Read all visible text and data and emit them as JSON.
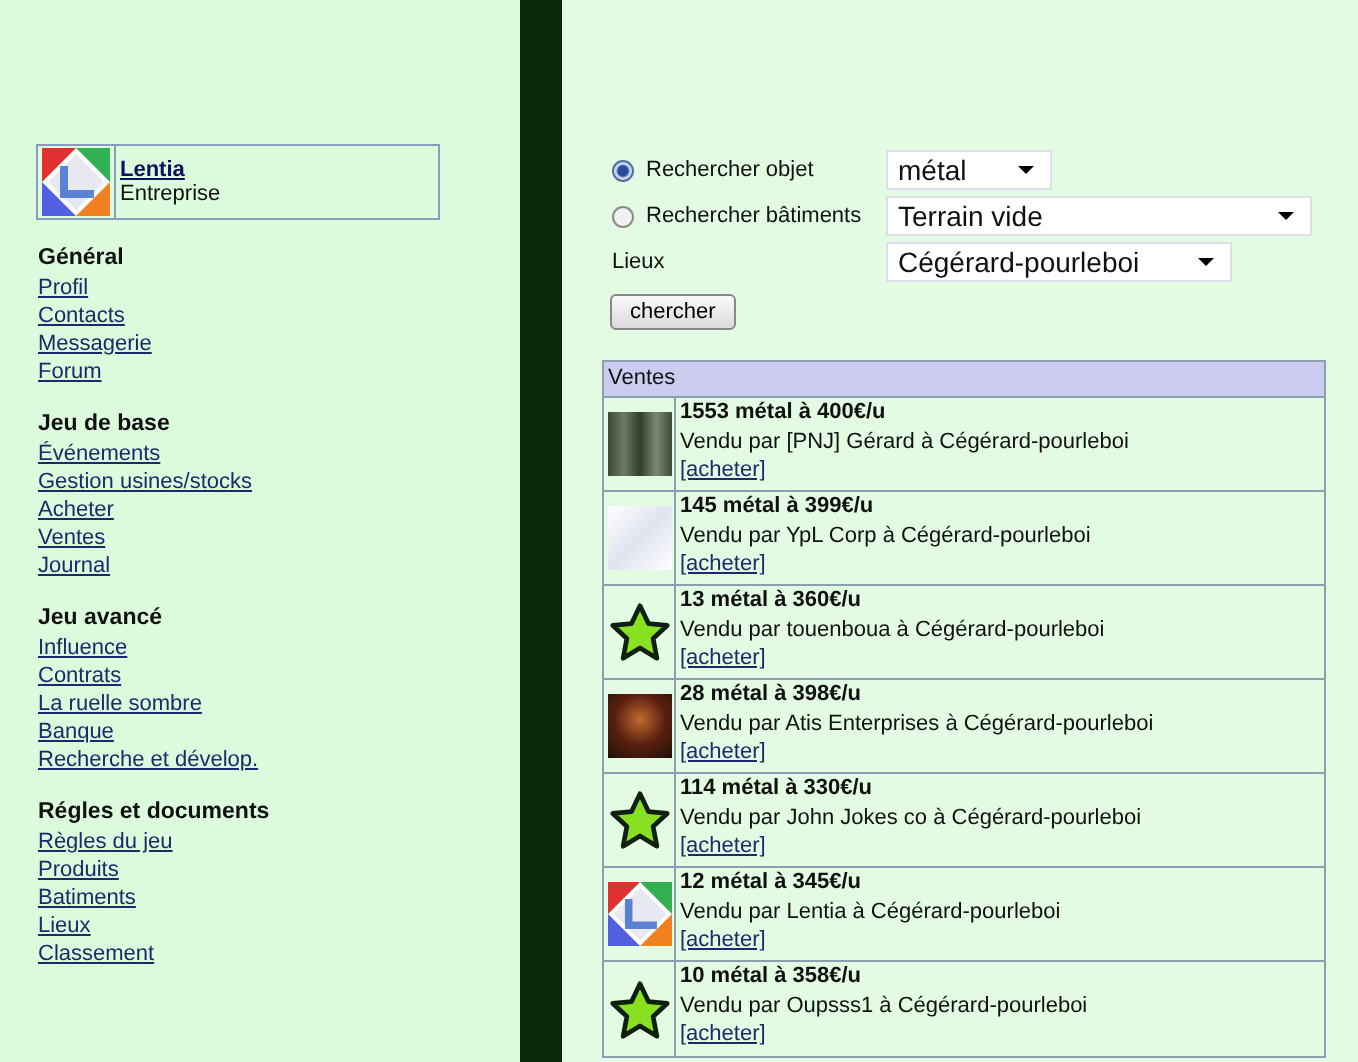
{
  "company": {
    "name": "Lentia",
    "type": "Entreprise"
  },
  "menu": [
    {
      "heading": "Général",
      "links": [
        "Profil",
        "Contacts",
        "Messagerie",
        "Forum"
      ]
    },
    {
      "heading": "Jeu de base",
      "links": [
        "Événements",
        "Gestion usines/stocks",
        "Acheter",
        "Ventes",
        "Journal"
      ]
    },
    {
      "heading": "Jeu avancé",
      "links": [
        "Influence",
        "Contrats",
        "La ruelle sombre",
        "Banque",
        "Recherche et dévelop."
      ]
    },
    {
      "heading": "Régles et documents",
      "links": [
        "Règles du jeu",
        "Produits",
        "Batiments",
        "Lieux",
        "Classement"
      ]
    }
  ],
  "search": {
    "options": [
      {
        "label": "Rechercher objet",
        "selected": true,
        "value": "métal"
      },
      {
        "label": "Rechercher bâtiments",
        "selected": false,
        "value": "Terrain vide"
      }
    ],
    "place": {
      "label": "Lieux",
      "value": "Cégérard-pourleboi"
    },
    "button": "chercher"
  },
  "sales": {
    "title": "Ventes",
    "rows": [
      {
        "kind": "forest-photo",
        "title": "1553 métal à 400€/u",
        "seller": "Vendu par [PNJ] Gérard à Cégérard-pourleboi",
        "action": "[acheter]"
      },
      {
        "kind": "pale-logo",
        "title": "145 métal à 399€/u",
        "seller": "Vendu par YpL Corp à Cégérard-pourleboi",
        "action": "[acheter]"
      },
      {
        "kind": "star",
        "title": "13 métal à 360€/u",
        "seller": "Vendu par touenboua à Cégérard-pourleboi",
        "action": "[acheter]"
      },
      {
        "kind": "night-photo",
        "title": "28 métal à 398€/u",
        "seller": "Vendu par Atis Enterprises à Cégérard-pourleboi",
        "action": "[acheter]"
      },
      {
        "kind": "star",
        "title": "114 métal à 330€/u",
        "seller": "Vendu par John Jokes co à Cégérard-pourleboi",
        "action": "[acheter]"
      },
      {
        "kind": "square-logo",
        "title": "12 métal à 345€/u",
        "seller": "Vendu par Lentia à Cégérard-pourleboi",
        "action": "[acheter]"
      },
      {
        "kind": "star",
        "title": "10 métal à 358€/u",
        "seller": "Vendu par Oupsss1 à Cégérard-pourleboi",
        "action": "[acheter]"
      }
    ]
  }
}
